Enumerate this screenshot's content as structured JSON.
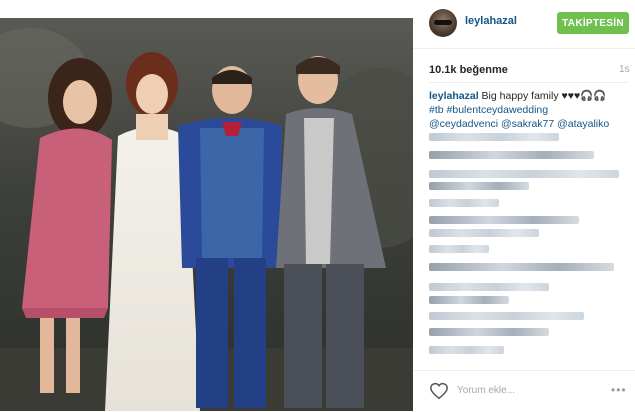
{
  "post": {
    "username": "leylahazal",
    "follow_label": "TAKİPTESİN",
    "likes": "10.1k beğenme",
    "age": "1s",
    "caption_user": "leylahazal",
    "caption_text": " Big happy family ♥♥♥🎧🎧",
    "hashtags": "#tb #bulentceydawedding",
    "mentions": "@ceydadvenci @sakrak77 @atayaliko"
  },
  "comment_box": {
    "placeholder": "Yorum ekle..."
  },
  "icons": {
    "like": "heart-outline-icon",
    "more": "more-dots-icon",
    "avatar": "avatar"
  },
  "colors": {
    "accent": "#125688",
    "follow": "#70c050",
    "muted": "#a5a7aa"
  }
}
